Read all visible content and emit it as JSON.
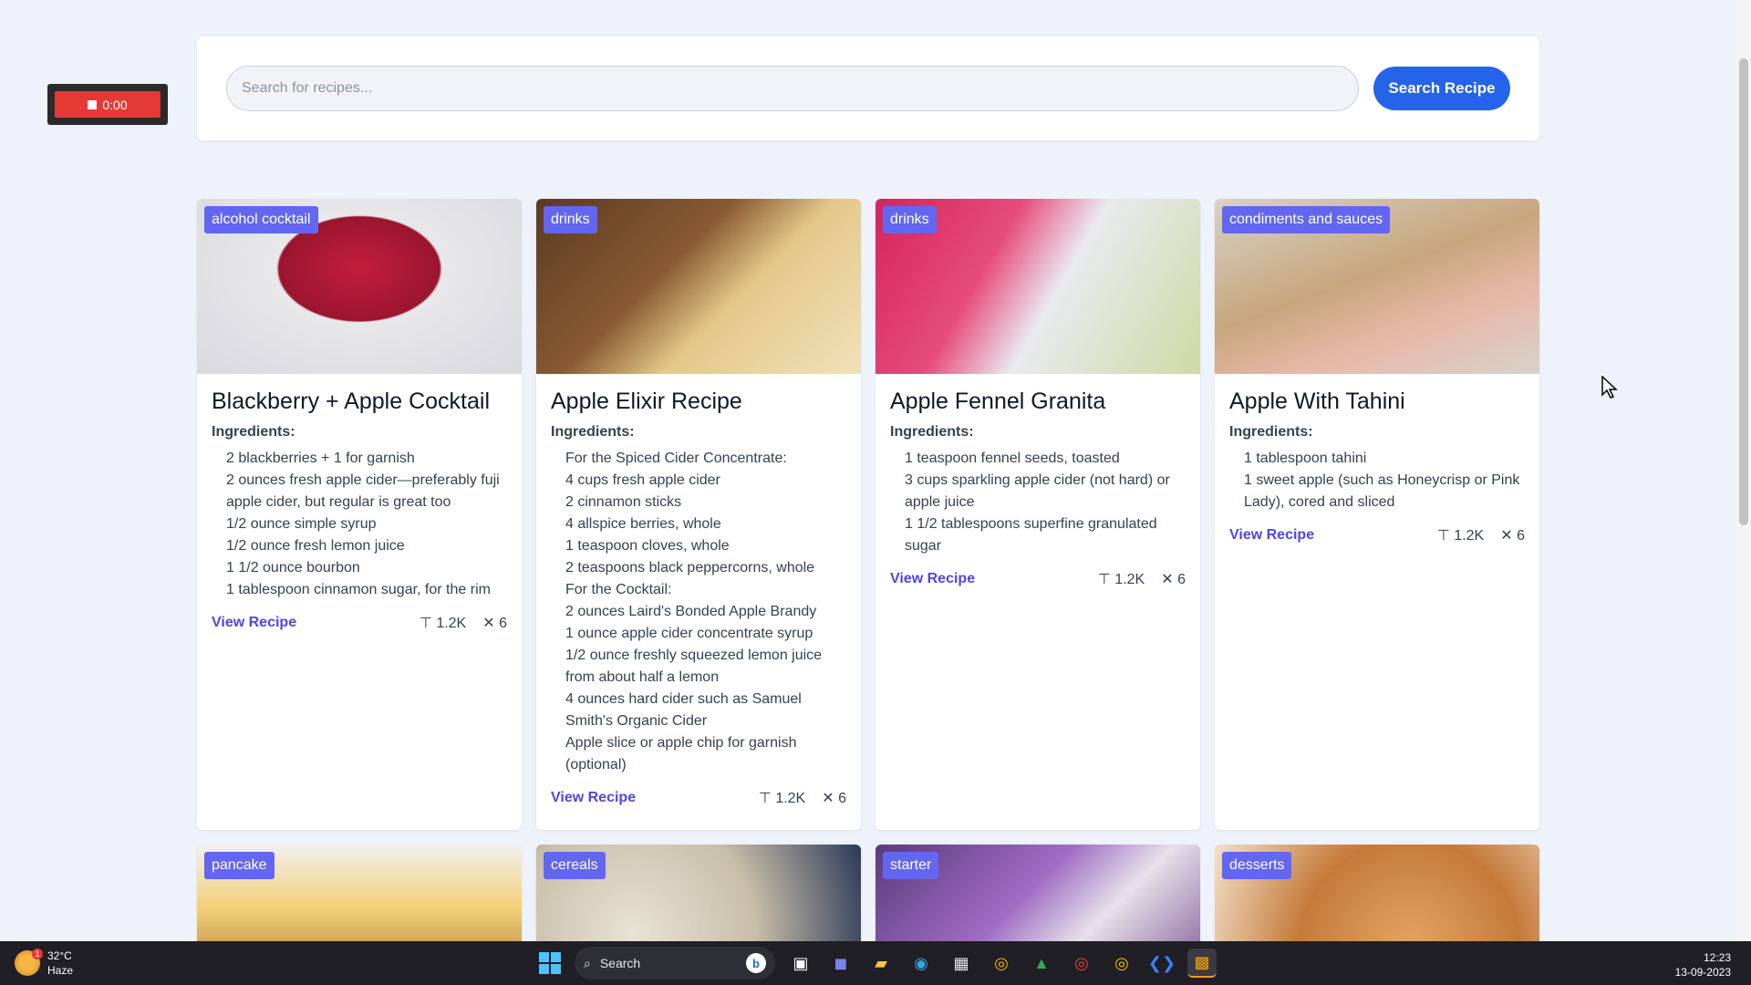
{
  "recorder": {
    "time": "0:00"
  },
  "search": {
    "placeholder": "Search for recipes...",
    "button_label": "Search Recipe"
  },
  "common": {
    "ingredients_label": "Ingredients:",
    "view_label": "View Recipe"
  },
  "cards": [
    {
      "category": "alcohol cocktail",
      "title": "Blackberry + Apple Cocktail",
      "ingredients": [
        "2 blackberries + 1 for garnish",
        "2 ounces fresh apple cider—preferably fuji apple cider, but regular is great too",
        "1/2 ounce simple syrup",
        "1/2 ounce fresh lemon juice",
        "1 1/2 ounce bourbon",
        "1 tablespoon cinnamon sugar, for the rim"
      ],
      "stat_a": "1.2K",
      "stat_b": "6"
    },
    {
      "category": "drinks",
      "title": "Apple Elixir Recipe",
      "ingredients": [
        "For the Spiced Cider Concentrate:",
        "4 cups fresh apple cider",
        "2 cinnamon sticks",
        "4 allspice berries, whole",
        "1 teaspoon cloves, whole",
        "2 teaspoons black peppercorns, whole",
        "For the Cocktail:",
        "2 ounces Laird's Bonded Apple Brandy",
        "1 ounce apple cider concentrate syrup",
        "1/2 ounce freshly squeezed lemon juice from about half a lemon",
        "4 ounces hard cider such as Samuel Smith's Organic Cider",
        "Apple slice or apple chip for garnish (optional)"
      ],
      "stat_a": "1.2K",
      "stat_b": "6"
    },
    {
      "category": "drinks",
      "title": "Apple Fennel Granita",
      "ingredients": [
        "1 teaspoon fennel seeds, toasted",
        "3 cups sparkling apple cider (not hard) or apple juice",
        "1 1/2 tablespoons superfine granulated sugar"
      ],
      "stat_a": "1.2K",
      "stat_b": "6"
    },
    {
      "category": "condiments and sauces",
      "title": "Apple With Tahini",
      "ingredients": [
        "1 tablespoon tahini",
        "1 sweet apple (such as Honeycrisp or Pink Lady), cored and sliced"
      ],
      "stat_a": "1.2K",
      "stat_b": "6"
    },
    {
      "category": "pancake"
    },
    {
      "category": "cereals"
    },
    {
      "category": "starter"
    },
    {
      "category": "desserts"
    }
  ],
  "taskbar": {
    "temperature": "32°C",
    "condition": "Haze",
    "weather_badge": "1",
    "search_label": "Search",
    "time": "12:23",
    "date": "13-09-2023"
  }
}
